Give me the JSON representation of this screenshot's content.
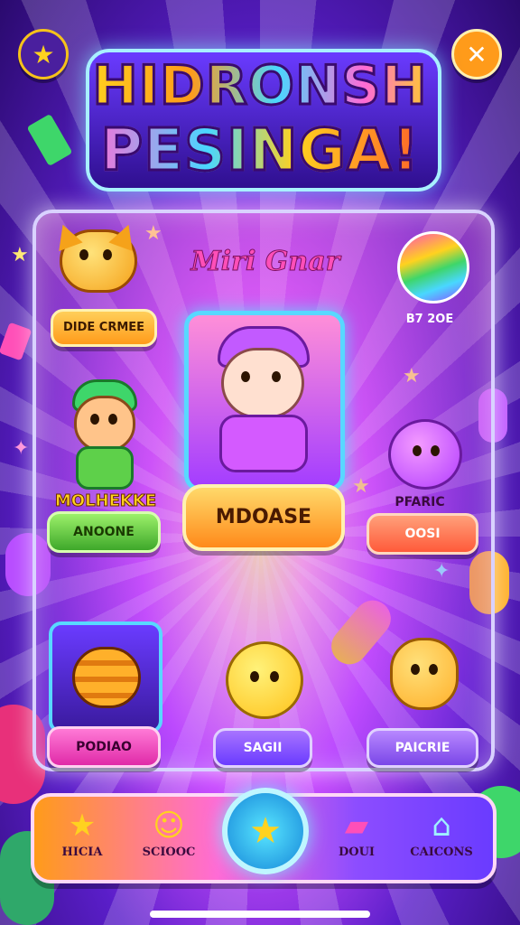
{
  "header": {
    "title_line1": "HIDRONSH",
    "title_line2": "PESINGA!",
    "star_icon": "star-icon",
    "close_icon": "close-icon"
  },
  "panel": {
    "title": "Miri Gnar",
    "featured": {
      "button_label": "MDOASE"
    },
    "items": [
      {
        "label": "DIDE CRMEE",
        "icon": "cat-icon"
      },
      {
        "label": "B7 2OE",
        "icon": "planet-ball-icon"
      },
      {
        "heading": "MOLHEKKE",
        "label": "ANOONE",
        "icon": "boy-character-icon"
      },
      {
        "heading": "PFARIC",
        "label": "OOSI",
        "icon": "purple-blob-icon"
      },
      {
        "label": "PODIAO",
        "icon": "burger-creature-icon"
      },
      {
        "label": "SAGII",
        "icon": "yellow-cat-face-icon"
      },
      {
        "label": "PAICRIE",
        "icon": "monster-character-icon"
      }
    ]
  },
  "nav": {
    "items": [
      {
        "label": "HICIA",
        "icon": "star-icon"
      },
      {
        "label": "SCIOOC",
        "icon": "smiley-icon"
      },
      {
        "label": "DOUI",
        "icon": "gift-card-icon"
      },
      {
        "label": "CAICONS",
        "icon": "robot-icon"
      }
    ],
    "center_icon": "star-icon"
  },
  "colors": {
    "accent_orange": "#ff9b1a",
    "accent_pink": "#ff6bd6",
    "accent_cyan": "#58d8ff",
    "accent_green": "#6ad62a",
    "accent_purple": "#6a3bff"
  }
}
